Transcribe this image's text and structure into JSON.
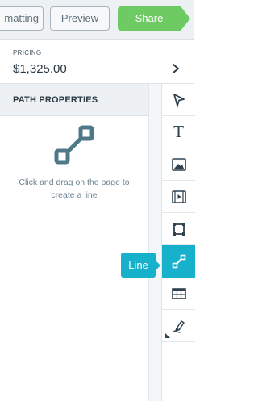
{
  "toolbar": {
    "formatting_label": "matting",
    "preview_label": "Preview",
    "share_label": "Share",
    "share_color": "#6ecb63"
  },
  "pricing": {
    "label": "PRICING",
    "value": "$1,325.00",
    "icon": "chevron-right-icon"
  },
  "path_properties": {
    "title": "PATH PROPERTIES",
    "icon": "line-tool-icon",
    "hint": "Click and drag on the page to create a line"
  },
  "tools": [
    {
      "name": "select",
      "icon": "cursor-arrow-icon"
    },
    {
      "name": "text",
      "icon": "text-icon",
      "glyph": "T"
    },
    {
      "name": "image",
      "icon": "image-icon"
    },
    {
      "name": "video",
      "icon": "video-icon"
    },
    {
      "name": "shape",
      "icon": "shape-square-icon"
    },
    {
      "name": "line",
      "icon": "line-icon",
      "active": true
    },
    {
      "name": "table",
      "icon": "table-icon"
    },
    {
      "name": "signature",
      "icon": "signature-pen-icon"
    }
  ],
  "tooltip": {
    "label": "Line",
    "color": "#17b1cc"
  },
  "colors": {
    "accent": "#17b1cc",
    "text": "#2b3a44",
    "hint": "#6b8290"
  }
}
